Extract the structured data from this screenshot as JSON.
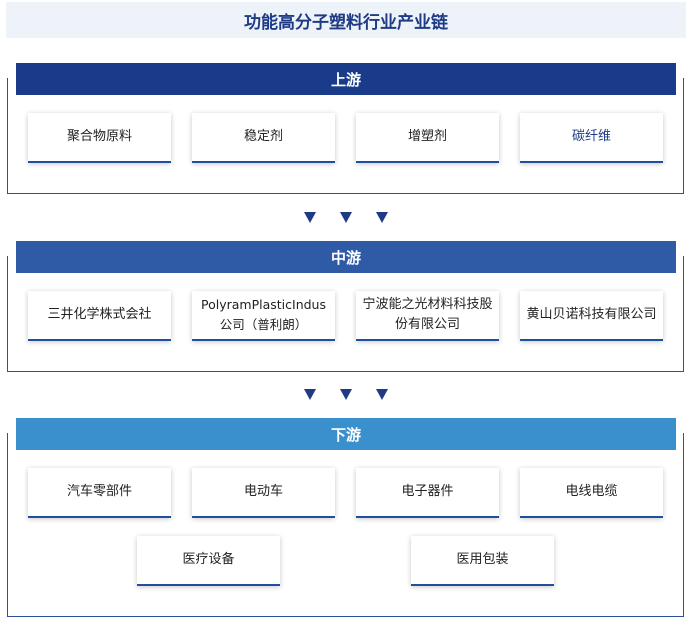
{
  "title": "功能高分子塑料行业产业链",
  "colors": {
    "upstream": "#1a3b8a",
    "midstream": "#2f5aa6",
    "downstream": "#3a90cc",
    "frame": "#2d4f9e",
    "arrow": "#1f3b86"
  },
  "upstream": {
    "label": "上游",
    "items": [
      "聚合物原料",
      "稳定剂",
      "增塑剂",
      "碳纤维"
    ]
  },
  "midstream": {
    "label": "中游",
    "items": [
      "三井化学株式会社",
      "PolyramPlasticIndus公司（普利朗）",
      "宁波能之光材料科技股份有限公司",
      "黄山贝诺科技有限公司"
    ]
  },
  "downstream": {
    "label": "下游",
    "items": [
      "汽车零部件",
      "电动车",
      "电子器件",
      "电线电缆",
      "医疗设备",
      "医用包装"
    ]
  }
}
